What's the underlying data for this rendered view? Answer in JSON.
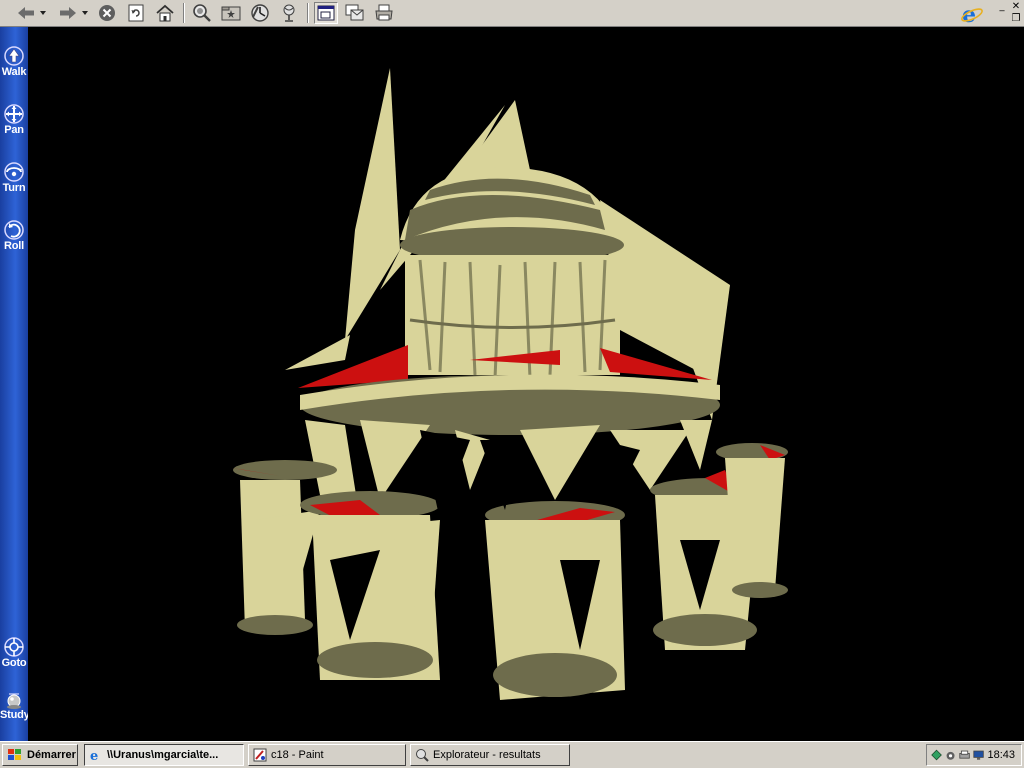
{
  "toolbar": {
    "buttons": [
      "back-icon",
      "forward-icon",
      "stop-icon",
      "refresh-icon",
      "home-icon",
      "search-icon",
      "favorites-icon",
      "history-icon",
      "channels-icon",
      "fullscreen-icon",
      "mail-icon",
      "print-icon"
    ],
    "colors": {
      "bar": "#d4d0c8"
    }
  },
  "nav": {
    "items": [
      {
        "label": "Walk",
        "icon": "walk-icon"
      },
      {
        "label": "Pan",
        "icon": "pan-icon"
      },
      {
        "label": "Turn",
        "icon": "turn-icon"
      },
      {
        "label": "Roll",
        "icon": "roll-icon"
      },
      {
        "label": "Goto",
        "icon": "goto-icon"
      },
      {
        "label": "Study",
        "icon": "study-icon"
      }
    ],
    "color": "#2e63d6"
  },
  "scene": {
    "description_icon": "3d-building-model",
    "colors": {
      "surface": "#d9d49a",
      "shade": "#6e6c4c",
      "accent": "#cc1010",
      "background": "#000000"
    }
  },
  "taskbar": {
    "start_label": "Démarrer",
    "tasks": [
      {
        "label": "\\\\Uranus\\mgarcia\\te...",
        "icon": "ie-icon"
      },
      {
        "label": "c18 - Paint",
        "icon": "paint-icon"
      },
      {
        "label": "Explorateur - resultats",
        "icon": "explorer-icon"
      }
    ],
    "clock": "18:43"
  }
}
